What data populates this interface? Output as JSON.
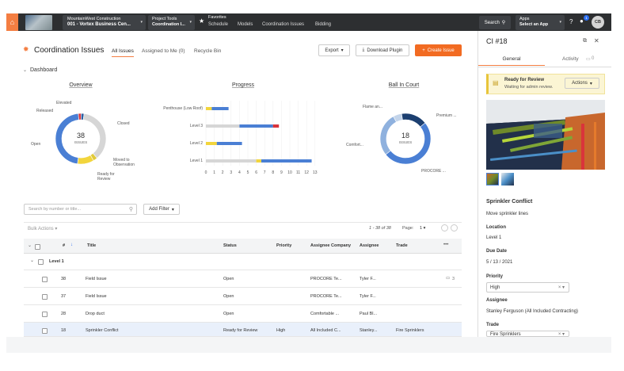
{
  "topbar": {
    "project_company": "MountainWest Construction",
    "project_name": "001 - Vortex Business Cen...",
    "tool_label": "Project Tools",
    "tool_value": "Coordination I...",
    "favorites_label": "Favorites",
    "nav": [
      "Schedule",
      "Models",
      "Coordination Issues",
      "Bidding"
    ],
    "search_label": "Search",
    "apps_label": "Apps",
    "apps_value": "Select an App",
    "notification_count": "1",
    "avatar_initials": "CB"
  },
  "header": {
    "title": "Coordination Issues",
    "tabs": [
      "All Issues",
      "Assigned to Me (0)",
      "Recycle Bin"
    ],
    "export_label": "Export",
    "download_label": "Download Plugin",
    "create_label": "Create Issue"
  },
  "dashboard": {
    "label": "Dashboard",
    "overview_title": "Overview",
    "progress_title": "Progress",
    "ballincourt_title": "Ball In Court",
    "overview_total": "38",
    "overview_unit": "ISSUES",
    "overview_labels": [
      "Elevated",
      "Released",
      "Closed",
      "Open",
      "Moved to Observation",
      "Ready for Review"
    ],
    "ball_total": "18",
    "ball_unit": "ISSUES",
    "ball_labels": [
      "Flame an...",
      "Premium ...",
      "Comfort...",
      "PROCORE ..."
    ]
  },
  "chart_data": [
    {
      "type": "pie",
      "title": "Overview",
      "slices": [
        {
          "label": "Elevated",
          "value": 0.7,
          "color": "#d9343b"
        },
        {
          "label": "Released",
          "value": 0.7,
          "color": "#2d5fa3"
        },
        {
          "label": "Closed",
          "value": 14,
          "color": "#d6d6d6"
        },
        {
          "label": "Moved to Observation",
          "value": 1,
          "color": "#e0c93a"
        },
        {
          "label": "Ready for Review",
          "value": 4,
          "color": "#f2d53c"
        },
        {
          "label": "Open",
          "value": 17.6,
          "color": "#4a7fd4"
        }
      ]
    },
    {
      "type": "bar",
      "title": "Progress",
      "categories": [
        "Penthouse (Low Roof)",
        "Level 3",
        "Level 2",
        "Level 1"
      ],
      "series": [
        {
          "values": [
            0,
            4,
            0,
            6
          ],
          "color": "#d6d6d6"
        },
        {
          "values": [
            0.7,
            0,
            1.3,
            0.6
          ],
          "color": "#f2d53c"
        },
        {
          "values": [
            2,
            4,
            3,
            6
          ],
          "color": "#4a7fd4"
        },
        {
          "values": [
            0,
            0.7,
            0,
            0
          ],
          "color": "#d9343b"
        }
      ],
      "ticks": [
        "0",
        "1",
        "2",
        "3",
        "4",
        "5",
        "6",
        "7",
        "8",
        "9",
        "10",
        "11",
        "12",
        "13"
      ],
      "xlim": [
        0,
        13
      ]
    },
    {
      "type": "pie",
      "title": "Ball In Court",
      "slices": [
        {
          "label": "Flame an...",
          "value": 1,
          "color": "#c3d4ea"
        },
        {
          "label": "Premium ...",
          "value": 3,
          "color": "#1c3f70"
        },
        {
          "label": "PROCORE ...",
          "value": 9,
          "color": "#4a7fd4"
        },
        {
          "label": "Comfort...",
          "value": 5,
          "color": "#8fb1de"
        }
      ]
    }
  ],
  "filters": {
    "search_placeholder": "Search by number or title...",
    "add_filter_label": "Add Filter",
    "bulk_actions_label": "Bulk Actions",
    "range_text": "1 - 38 of 38",
    "page_label": "Page:",
    "page_value": "1"
  },
  "table": {
    "columns": [
      "#",
      "Title",
      "Status",
      "Priority",
      "Assignee Company",
      "Assignee",
      "Trade"
    ],
    "group_label": "Level 1",
    "rows": [
      {
        "num": "38",
        "title": "Field Issue",
        "status": "Open",
        "priority": "",
        "company": "PROCORE Te...",
        "assignee": "Tyler F...",
        "trade": "",
        "comments": "3"
      },
      {
        "num": "37",
        "title": "Field Issue",
        "status": "Open",
        "priority": "",
        "company": "PROCORE Te...",
        "assignee": "Tyler F...",
        "trade": "",
        "comments": ""
      },
      {
        "num": "28",
        "title": "Drop duct",
        "status": "Open",
        "priority": "",
        "company": "Comfortable ...",
        "assignee": "Paul Bl...",
        "trade": "",
        "comments": ""
      },
      {
        "num": "18",
        "title": "Sprinkler Conflict",
        "status": "Ready for Review",
        "priority": "High",
        "company": "All Included C...",
        "assignee": "Stanley...",
        "trade": "Fire Sprinklers",
        "comments": ""
      }
    ]
  },
  "panel": {
    "title": "CI #18",
    "tab_general": "General",
    "tab_activity": "Activity",
    "activity_count": "0",
    "status_title": "Ready for Review",
    "status_sub": "Waiting for admin review.",
    "actions_label": "Actions",
    "issue_title": "Sprinkler Conflict",
    "description": "Move sprinkler lines",
    "location_label": "Location",
    "location_value": "Level 1",
    "due_label": "Due Date",
    "due_value": "5  /  13  /  2021",
    "priority_label": "Priority",
    "priority_value": "High",
    "assignee_label": "Assignee",
    "assignee_value": "Stanley Ferguson (All Included Contracting)",
    "trade_label": "Trade",
    "trade_value": "Fire Sprinklers"
  }
}
